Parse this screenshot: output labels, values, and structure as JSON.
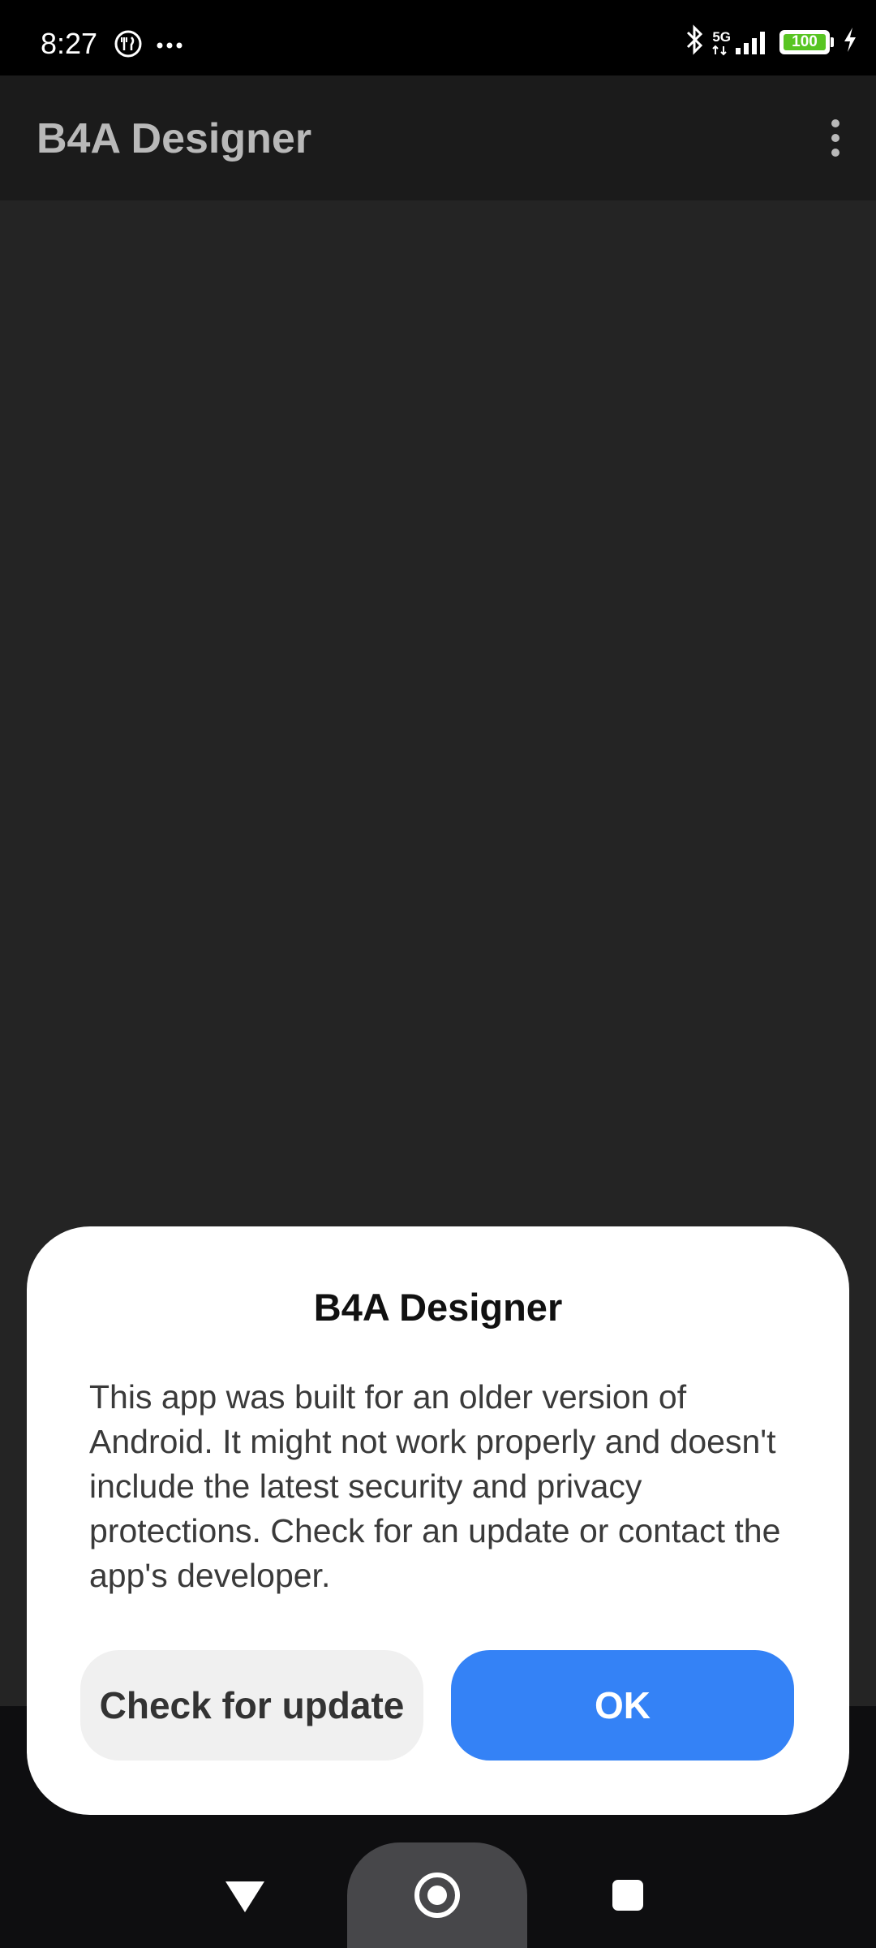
{
  "status_bar": {
    "time": "8:27",
    "left_icons": [
      "fork-knife-icon",
      "more-notifications-icon"
    ],
    "network": "5G",
    "battery_level": 100,
    "battery_label": "100",
    "battery_color": "#58c522",
    "right_icons": [
      "bluetooth-icon",
      "signal-icon",
      "battery-icon",
      "charging-icon"
    ]
  },
  "app_bar": {
    "title": "B4A Designer",
    "menu_icon": "overflow-menu-icon"
  },
  "dialog": {
    "title": "B4A Designer",
    "message": "This app was built for an older version of Android. It might not work properly and doesn't include the latest security and privacy protections. Check for an update or contact the app's developer.",
    "secondary_button": "Check for update",
    "primary_button": "OK",
    "primary_color": "#3482f6"
  },
  "nav_bar": {
    "back_icon": "back-triangle-icon",
    "home_icon": "home-circle-icon",
    "recents_icon": "recents-square-icon"
  }
}
